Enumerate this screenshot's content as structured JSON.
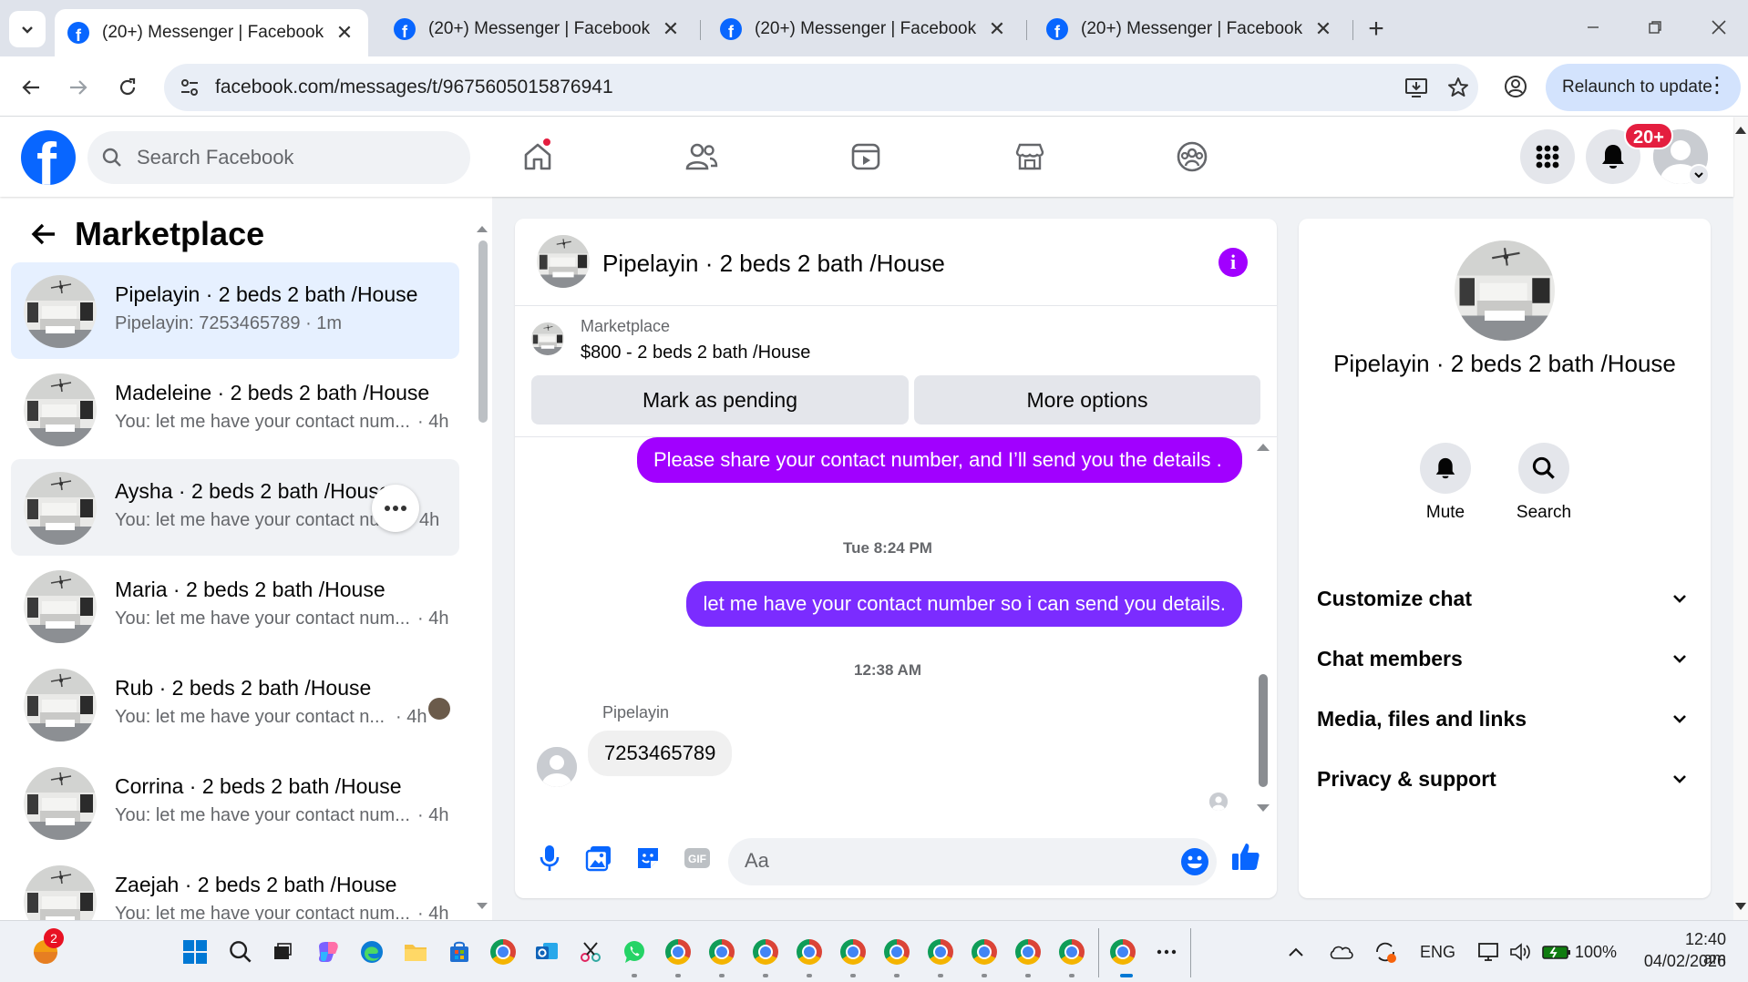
{
  "browser": {
    "tabs": [
      {
        "title": "(20+) Messenger | Facebook",
        "active": true
      },
      {
        "title": "(20+) Messenger | Facebook",
        "active": false
      },
      {
        "title": "(20+) Messenger | Facebook",
        "active": false
      },
      {
        "title": "(20+) Messenger | Facebook",
        "active": false
      }
    ],
    "url": "facebook.com/messages/t/9675605015876941",
    "relaunch_label": "Relaunch to update"
  },
  "fb_header": {
    "search_placeholder": "Search Facebook",
    "notification_badge": "20+"
  },
  "sidebar": {
    "title": "Marketplace",
    "conversations": [
      {
        "name": "Pipelayin · 2 beds 2 bath /House",
        "preview": "Pipelayin: 7253465789 · 1m",
        "time": ""
      },
      {
        "name": "Madeleine · 2 beds 2 bath /House",
        "preview": "You: let me have your contact num...",
        "time": "· 4h"
      },
      {
        "name": "Aysha · 2 beds 2 bath /House",
        "preview": "You: let me have your contact num",
        "time": "4h"
      },
      {
        "name": "Maria · 2 beds 2 bath /House",
        "preview": "You: let me have your contact num...",
        "time": "· 4h"
      },
      {
        "name": "Rub · 2 beds 2 bath /House",
        "preview": "You: let me have your contact n...",
        "time": "· 4h"
      },
      {
        "name": "Corrina · 2 beds 2 bath /House",
        "preview": "You: let me have your contact num...",
        "time": "· 4h"
      },
      {
        "name": "Zaejah · 2 beds 2 bath /House",
        "preview": "You: let me have your contact num...",
        "time": "· 4h"
      }
    ]
  },
  "chat": {
    "title": "Pipelayin · 2 beds 2 bath /House",
    "listing": {
      "source": "Marketplace",
      "price_title": "$800 - 2 beds 2 bath /House",
      "mark_pending": "Mark as pending",
      "more_options": "More options"
    },
    "messages": [
      {
        "type": "out",
        "text": "Please share your contact number, and I’ll send you the details ."
      },
      {
        "type": "timestamp",
        "text": "Tue 8:24 PM"
      },
      {
        "type": "out",
        "text": "let me have your contact number so i can send you details."
      },
      {
        "type": "timestamp",
        "text": "12:38 AM"
      },
      {
        "type": "sender",
        "text": "Pipelayin"
      },
      {
        "type": "in",
        "text": "7253465789"
      }
    ],
    "composer_placeholder": "Aa"
  },
  "info_panel": {
    "name": "Pipelayin · 2 beds 2 bath /House",
    "actions": [
      {
        "label": "Mute",
        "icon": "bell-icon"
      },
      {
        "label": "Search",
        "icon": "search-icon"
      }
    ],
    "sections": [
      "Customize chat",
      "Chat members",
      "Media, files and links",
      "Privacy & support"
    ]
  },
  "taskbar": {
    "weather_badge": "2",
    "language": "ENG",
    "battery": "100%",
    "time": "12:40 am",
    "date": "04/02/2026"
  },
  "colors": {
    "fb_blue": "#0866ff",
    "message_gradient_top": "#a100ff",
    "message_gradient_bottom": "#7b2cff",
    "selected_row": "#e6f0ff"
  }
}
